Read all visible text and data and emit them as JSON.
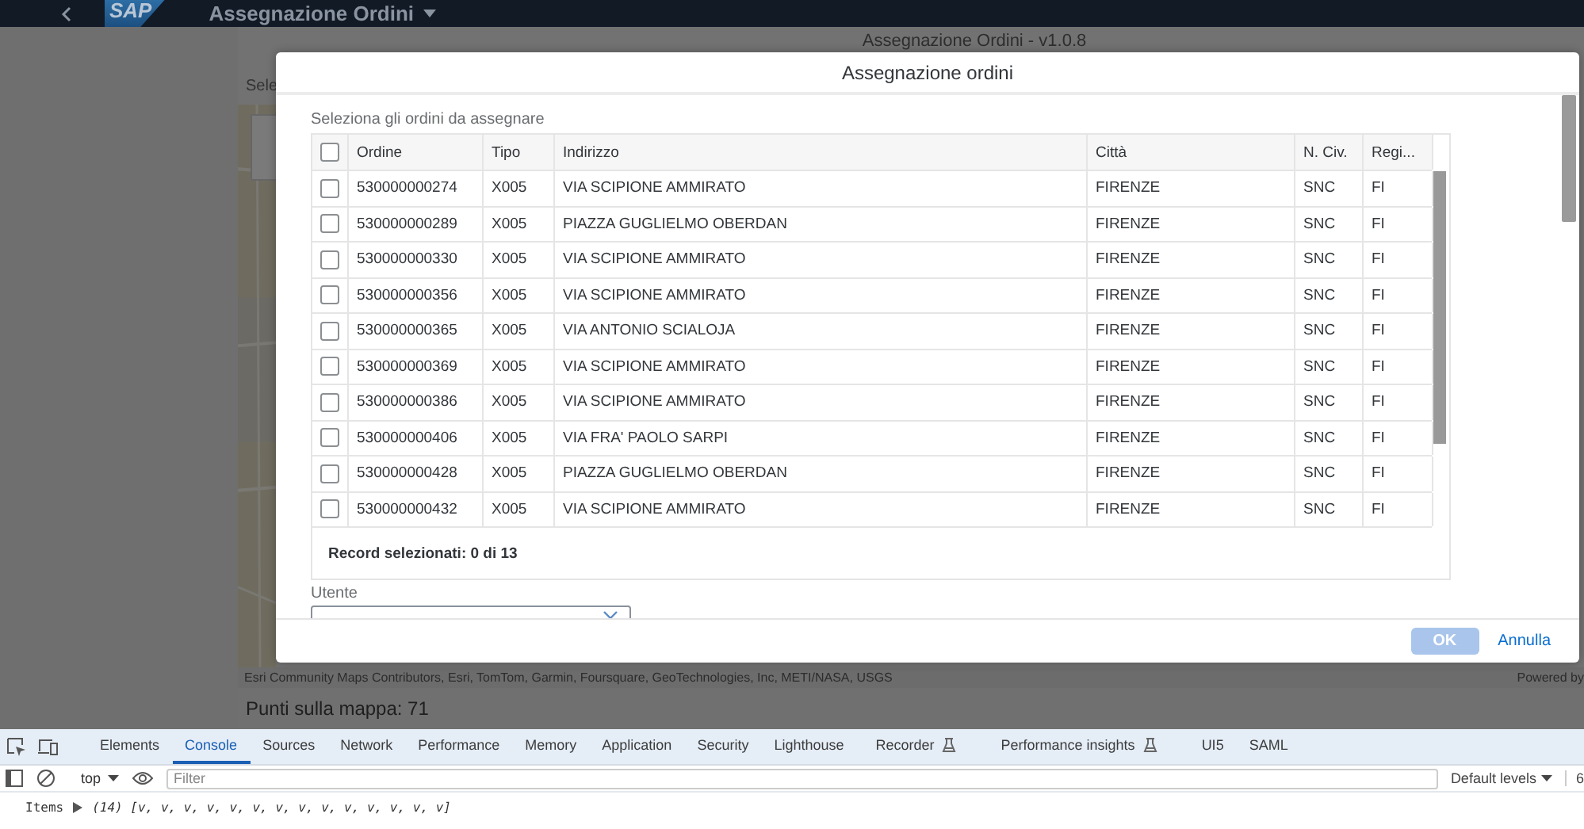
{
  "shell": {
    "logo": "SAP",
    "title": "Assegnazione Ordini"
  },
  "page": {
    "title": "Assegnazione Ordini - v1.0.8",
    "label": "Sele",
    "attribution": "Esri Community Maps Contributors, Esri, TomTom, Garmin, Foursquare, GeoTechnologies, Inc, METI/NASA, USGS",
    "powered": "Powered by",
    "points": "Punti sulla mappa: 71"
  },
  "dialog": {
    "title": "Assegnazione ordini",
    "table_label": "Seleziona gli ordini da assegnare",
    "header_checked": false,
    "columns": [
      "Ordine",
      "Tipo",
      "Indirizzo",
      "Città",
      "N. Civ.",
      "Regi..."
    ],
    "rows": [
      {
        "checked": false,
        "cells": [
          "530000000274",
          "X005",
          "VIA SCIPIONE AMMIRATO",
          "FIRENZE",
          "SNC",
          "FI"
        ]
      },
      {
        "checked": false,
        "cells": [
          "530000000289",
          "X005",
          "PIAZZA GUGLIELMO OBERDAN",
          "FIRENZE",
          "SNC",
          "FI"
        ]
      },
      {
        "checked": false,
        "cells": [
          "530000000330",
          "X005",
          "VIA SCIPIONE AMMIRATO",
          "FIRENZE",
          "SNC",
          "FI"
        ]
      },
      {
        "checked": false,
        "cells": [
          "530000000356",
          "X005",
          "VIA SCIPIONE AMMIRATO",
          "FIRENZE",
          "SNC",
          "FI"
        ]
      },
      {
        "checked": false,
        "cells": [
          "530000000365",
          "X005",
          "VIA ANTONIO SCIALOJA",
          "FIRENZE",
          "SNC",
          "FI"
        ]
      },
      {
        "checked": false,
        "cells": [
          "530000000369",
          "X005",
          "VIA SCIPIONE AMMIRATO",
          "FIRENZE",
          "SNC",
          "FI"
        ]
      },
      {
        "checked": false,
        "cells": [
          "530000000386",
          "X005",
          "VIA SCIPIONE AMMIRATO",
          "FIRENZE",
          "SNC",
          "FI"
        ]
      },
      {
        "checked": false,
        "cells": [
          "530000000406",
          "X005",
          "VIA FRA' PAOLO SARPI",
          "FIRENZE",
          "SNC",
          "FI"
        ]
      },
      {
        "checked": false,
        "cells": [
          "530000000428",
          "X005",
          "PIAZZA GUGLIELMO OBERDAN",
          "FIRENZE",
          "SNC",
          "FI"
        ]
      },
      {
        "checked": false,
        "cells": [
          "530000000432",
          "X005",
          "VIA SCIPIONE AMMIRATO",
          "FIRENZE",
          "SNC",
          "FI"
        ]
      }
    ],
    "footer": "Record selezionati: 0 di 13",
    "user_label": "Utente",
    "buttons": [
      {
        "label": "OK",
        "kind": "emphasized",
        "disabled": true
      },
      {
        "label": "Annulla",
        "kind": "transparent",
        "disabled": false
      }
    ]
  },
  "devtools": {
    "tabs": [
      {
        "label": "Elements",
        "selected": false,
        "experimental": false
      },
      {
        "label": "Console",
        "selected": true,
        "experimental": false
      },
      {
        "label": "Sources",
        "selected": false,
        "experimental": false
      },
      {
        "label": "Network",
        "selected": false,
        "experimental": false
      },
      {
        "label": "Performance",
        "selected": false,
        "experimental": false
      },
      {
        "label": "Memory",
        "selected": false,
        "experimental": false
      },
      {
        "label": "Application",
        "selected": false,
        "experimental": false
      },
      {
        "label": "Security",
        "selected": false,
        "experimental": false
      },
      {
        "label": "Lighthouse",
        "selected": false,
        "experimental": false
      },
      {
        "label": "Recorder",
        "selected": false,
        "experimental": true
      },
      {
        "label": "Performance insights",
        "selected": false,
        "experimental": true
      },
      {
        "label": "UI5",
        "selected": false,
        "experimental": false
      },
      {
        "label": "SAML",
        "selected": false,
        "experimental": false
      }
    ],
    "context": "top",
    "filter_placeholder": "Filter",
    "levels": "Default levels",
    "edge_text": "6",
    "console": [
      {
        "label": "Items",
        "count": "(14)",
        "value": "[v, v, v, v, v, v, v, v, v, v, v, v, v, v]"
      }
    ]
  }
}
